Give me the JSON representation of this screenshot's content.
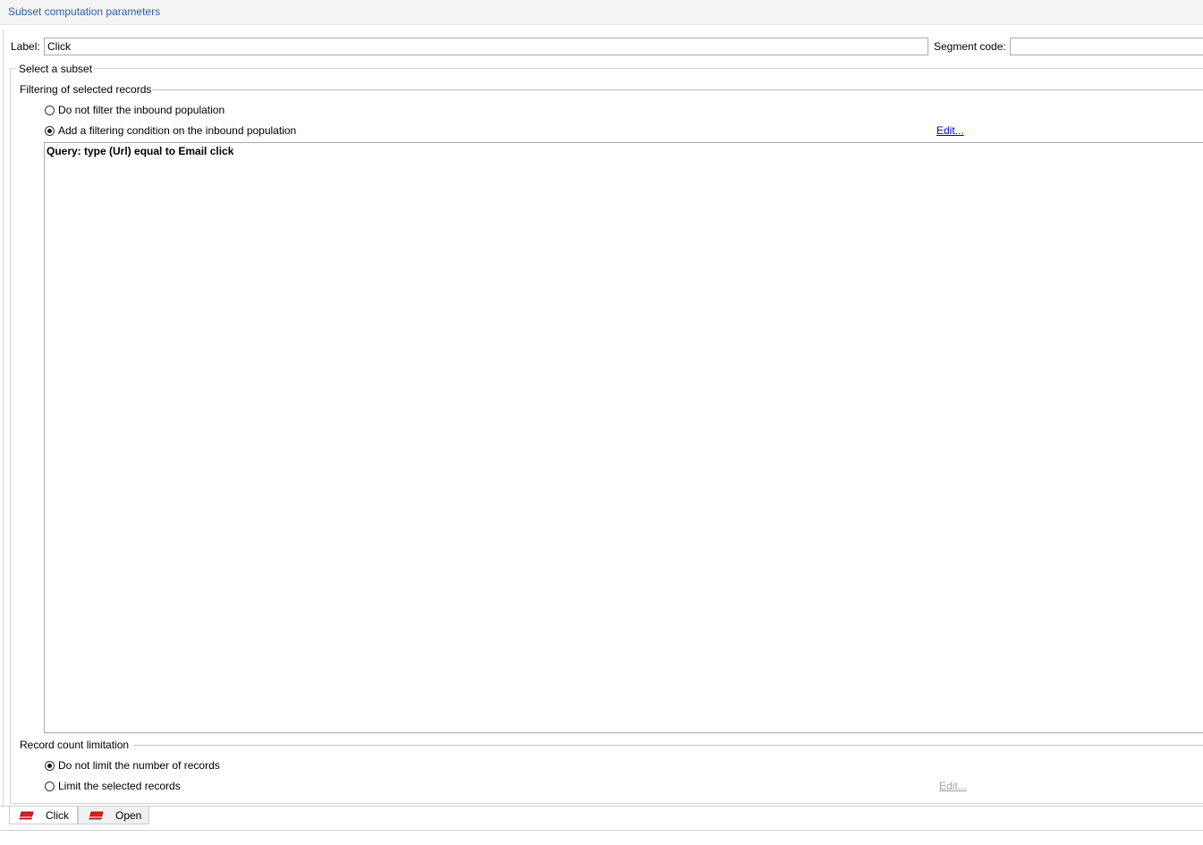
{
  "header": {
    "title": "Subset computation parameters"
  },
  "form": {
    "label_caption": "Label:",
    "label_value": "Click",
    "segment_caption": "Segment code:",
    "segment_value": ""
  },
  "subset_group": {
    "title": "Select a subset"
  },
  "filtering": {
    "title": "Filtering of selected records",
    "options": [
      {
        "label": "Do not filter the inbound population",
        "checked": false
      },
      {
        "label": "Add a filtering condition on the inbound population",
        "checked": true
      }
    ],
    "edit_link": "Edit...",
    "query_text": "Query: type (Url) equal to Email click"
  },
  "limitation": {
    "title": "Record count limitation",
    "options": [
      {
        "label": "Do not limit the number of records",
        "checked": true
      },
      {
        "label": "Limit the selected records",
        "checked": false
      }
    ],
    "edit_link": "Edit..."
  },
  "tabs": [
    {
      "label": "Click",
      "icon": "eraser-icon",
      "active": true
    },
    {
      "label": "Open",
      "icon": "eraser-icon",
      "active": false
    }
  ],
  "colors": {
    "accent_title": "#2a5ea8",
    "link": "#0000d0",
    "icon_red": "#d62020"
  }
}
